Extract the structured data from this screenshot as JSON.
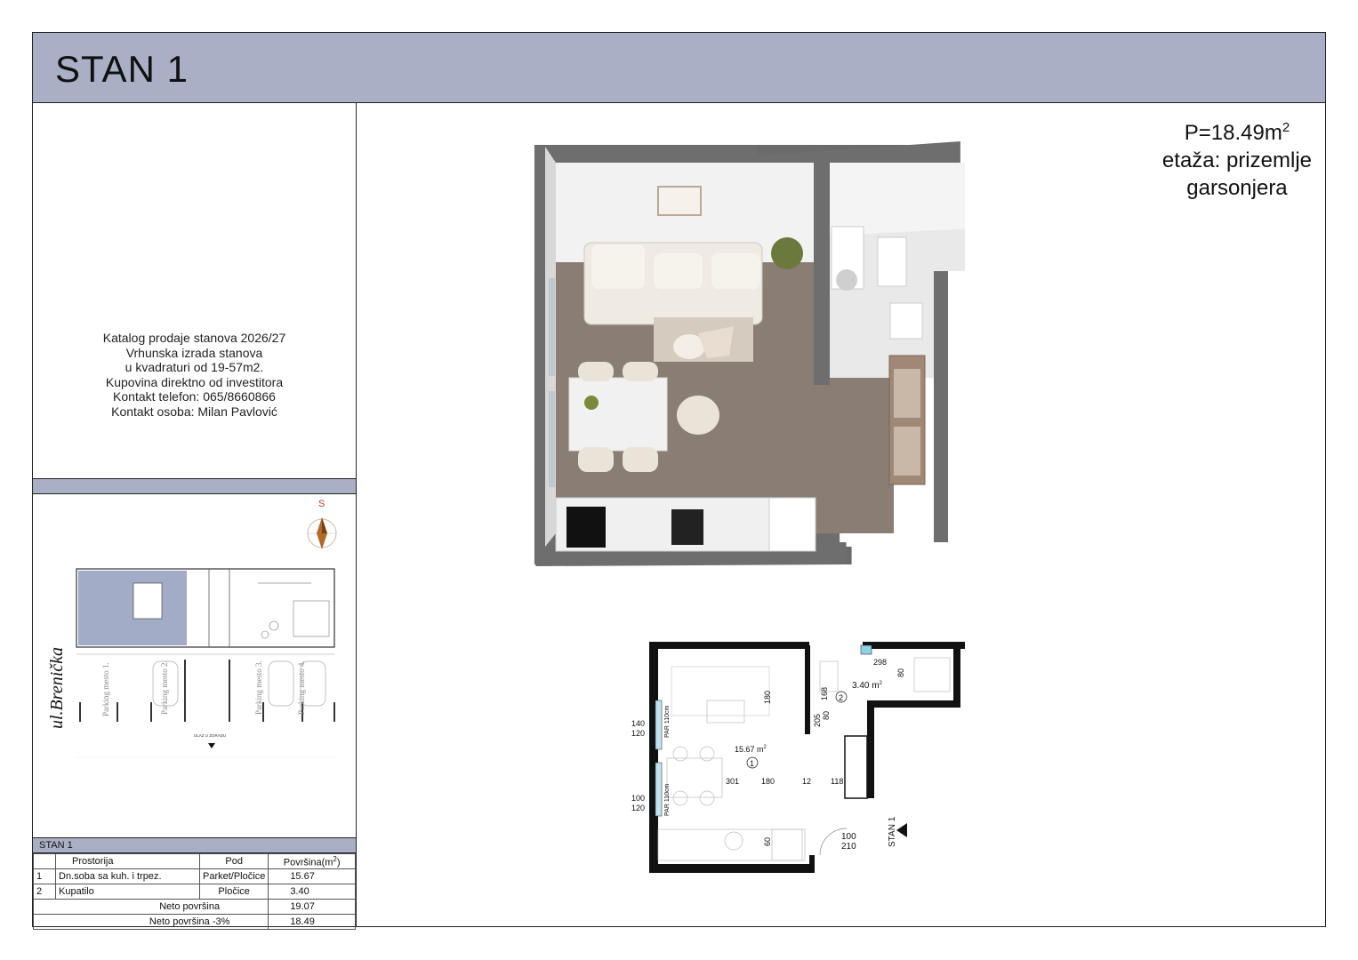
{
  "title": "STAN 1",
  "summary": {
    "area": "P=18.49m",
    "area_sup": "2",
    "floor": "etaža: prizemlje",
    "type": "garsonjera"
  },
  "info": {
    "line1": "Katalog prodaje stanova 2026/27",
    "line2": "Vrhunska izrada stanova",
    "line3": "u kvadraturi od 19-57m2.",
    "line4": "Kupovina direktno od investitora",
    "line5": "Kontakt telefon: 065/8660866",
    "line6": "Kontakt osoba: Milan Pavlović"
  },
  "site_plan": {
    "street": "ul.Brenička",
    "compass": "S",
    "parking": [
      "Parking mesto 1.",
      "Parking mesto 2.",
      "Parking mesto 3.",
      "Parking mesto 4."
    ],
    "entrance": "ULAZ U ZGRADU"
  },
  "table": {
    "title": "STAN 1",
    "headers": [
      "Prostorija",
      "Pod",
      "Površina(m",
      "2",
      ")"
    ],
    "rows": [
      {
        "no": "1",
        "room": "Dn.soba sa kuh. i trpez.",
        "floor": "Parket/Pločice",
        "area": "15.67"
      },
      {
        "no": "2",
        "room": "Kupatilo",
        "floor": "Pločice",
        "area": "3.40"
      }
    ],
    "net_label": "Neto površina",
    "net_value": "19.07",
    "net3_label": "Neto površina -3%",
    "net3_value": "18.49"
  },
  "plan": {
    "room1_area": "15.67 m",
    "room1_no": "1",
    "room2_area": "3.40 m",
    "room2_no": "2",
    "sup": "2",
    "label": "STAN 1",
    "dims": {
      "d298": "298",
      "d80a": "80",
      "d180a": "180",
      "d168": "168",
      "d205": "205",
      "d80b": "80",
      "d140": "140",
      "d120a": "120",
      "par1": "PAR 110cm",
      "par2": "PAR 110cm",
      "d301": "301",
      "d180b": "180",
      "d12": "12",
      "d118": "118",
      "d100a": "100",
      "d120b": "120",
      "d60": "60",
      "d100b": "100",
      "d210": "210"
    }
  },
  "colors": {
    "header_band": "#a9b0c6",
    "wall": "#6e6e6e",
    "floor_wood": "#8a7d74"
  }
}
